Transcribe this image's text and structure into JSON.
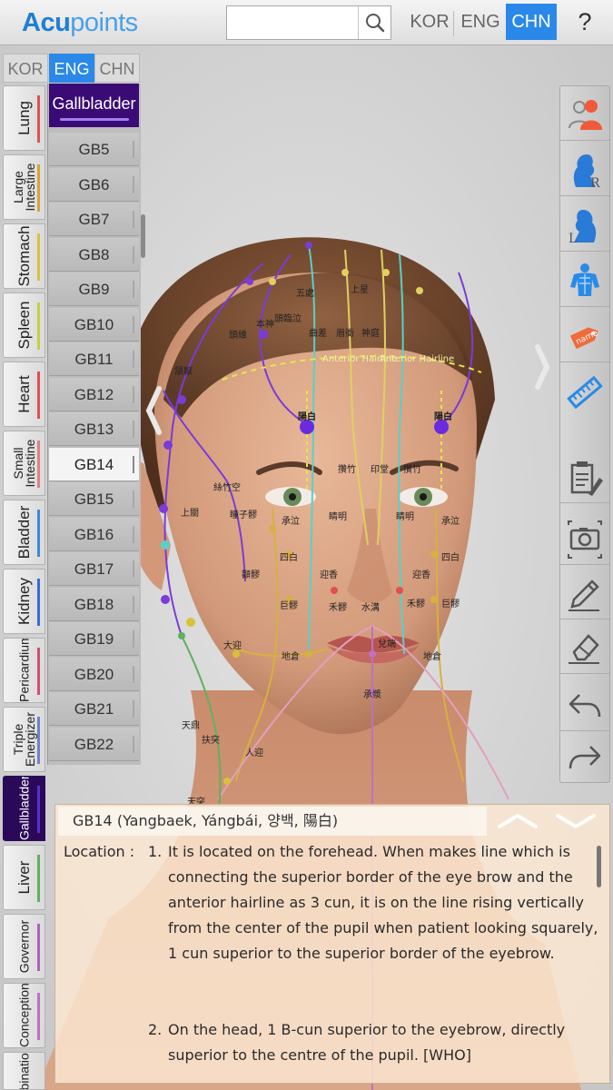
{
  "app": {
    "logo_bold": "Acu",
    "logo_light": "points",
    "help_label": "?"
  },
  "search": {
    "placeholder": "",
    "value": ""
  },
  "top_languages": [
    {
      "label": "KOR",
      "active": false
    },
    {
      "label": "ENG",
      "active": false
    },
    {
      "label": "CHN",
      "active": true
    }
  ],
  "side_languages": [
    {
      "label": "KOR",
      "active": false
    },
    {
      "label": "ENG",
      "active": true
    },
    {
      "label": "CHN",
      "active": false
    }
  ],
  "meridians": [
    {
      "label": "Lung",
      "color": "#e05050",
      "active": false
    },
    {
      "label": "Large\nIntestine",
      "color": "#d8a23a",
      "active": false
    },
    {
      "label": "Stomach",
      "color": "#d8c23a",
      "active": false
    },
    {
      "label": "Spleen",
      "color": "#c8d040",
      "active": false
    },
    {
      "label": "Heart",
      "color": "#e05050",
      "active": false
    },
    {
      "label": "Small\nIntestine",
      "color": "#e08080",
      "active": false
    },
    {
      "label": "Bladder",
      "color": "#3a8ad8",
      "active": false
    },
    {
      "label": "Kidney",
      "color": "#3a6ad8",
      "active": false
    },
    {
      "label": "Pericardium",
      "color": "#d05070",
      "active": false
    },
    {
      "label": "Triple\nEnergizer",
      "color": "#7080d0",
      "active": false
    },
    {
      "label": "Gallbladder",
      "color": "#5a30d0",
      "active": true
    },
    {
      "label": "Liver",
      "color": "#60b060",
      "active": false
    },
    {
      "label": "Governor",
      "color": "#b060c0",
      "active": false
    },
    {
      "label": "Conception",
      "color": "#c070c0",
      "active": false
    },
    {
      "label": "Combination",
      "color": "#6a6ad0",
      "active": false
    }
  ],
  "point_list": {
    "header": "Gallbladder",
    "items": [
      "GB5",
      "GB6",
      "GB7",
      "GB8",
      "GB9",
      "GB10",
      "GB11",
      "GB12",
      "GB13",
      "GB14",
      "GB15",
      "GB16",
      "GB17",
      "GB18",
      "GB19",
      "GB20",
      "GB21",
      "GB22"
    ],
    "selected": "GB14"
  },
  "toolbar": [
    {
      "name": "tool-view-mode",
      "icon": "person-toggle-icon"
    },
    {
      "name": "tool-right-side",
      "icon": "right-profile-icon"
    },
    {
      "name": "tool-left-side",
      "icon": "left-profile-icon"
    },
    {
      "name": "tool-muscle",
      "icon": "muscle-body-icon"
    },
    {
      "name": "tool-name-tag",
      "icon": "name-tag-icon"
    },
    {
      "name": "tool-ruler",
      "icon": "ruler-icon"
    },
    {
      "name": "tool-notes",
      "icon": "clipboard-pencil-icon"
    },
    {
      "name": "tool-camera",
      "icon": "camera-icon"
    },
    {
      "name": "tool-pencil",
      "icon": "pencil-icon"
    },
    {
      "name": "tool-eraser",
      "icon": "eraser-icon"
    },
    {
      "name": "tool-undo",
      "icon": "undo-icon"
    },
    {
      "name": "tool-redo",
      "icon": "redo-icon"
    }
  ],
  "model_labels": {
    "hairline": "Anterior Hairline",
    "points": [
      "陽白",
      "陽白",
      "瞳子髎",
      "承泣",
      "睛明",
      "睛明",
      "承泣",
      "四白",
      "迎香",
      "迎香",
      "四白",
      "巨髎",
      "禾髎",
      "水溝",
      "禾髎",
      "巨髎",
      "地倉",
      "地倉",
      "承漿",
      "大迎",
      "人迎",
      "天鼎",
      "扶突",
      "顴髎",
      "顴髎",
      "上關",
      "頭維",
      "頷厭",
      "本神",
      "頭臨泣",
      "五處",
      "曲差",
      "眉衝",
      "神庭",
      "上星",
      "攢竹",
      "攢竹",
      "印堂",
      "絲竹空",
      "兌端",
      "天突"
    ]
  },
  "info": {
    "title": "GB14 (Yangbaek, Yángbái, 양백, 陽白)",
    "location_label": "Location :",
    "item1_num": "1.",
    "item1_text": "It is located on the forehead. When makes line which is connecting the superior border of the eye brow and the anterior hairline as 3 cun, it is on the line rising vertically from the center of the pupil when patient looking squarely, 1 cun superior to the superior border of the eyebrow.",
    "item2_num": "2.",
    "item2_text": "On the head, 1 B-cun superior to the eyebrow, directly superior to the centre of the pupil. [WHO]"
  }
}
